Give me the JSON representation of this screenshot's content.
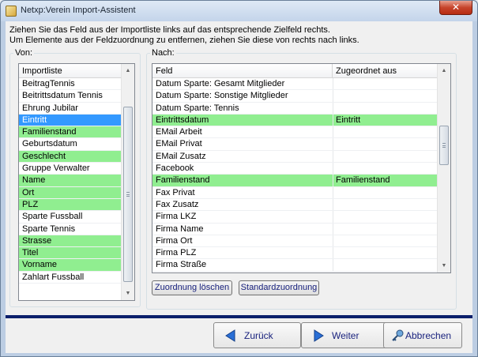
{
  "window": {
    "title": "Netxp:Verein Import-Assistent",
    "close_symbol": "✕"
  },
  "instructions": {
    "line1": "Ziehen Sie das Feld aus der Importliste links auf das entsprechende Zielfeld rechts.",
    "line2": "Um Elemente aus der Feldzuordnung zu entfernen, ziehen Sie diese von rechts nach links."
  },
  "from_group": {
    "label": "Von:",
    "header": "Importliste",
    "items": [
      {
        "label": "BeitragTennis",
        "state": ""
      },
      {
        "label": "Beitrittsdatum Tennis",
        "state": ""
      },
      {
        "label": "Ehrung Jubilar",
        "state": ""
      },
      {
        "label": "Eintritt",
        "state": "selected"
      },
      {
        "label": "Familienstand",
        "state": "green"
      },
      {
        "label": "Geburtsdatum",
        "state": ""
      },
      {
        "label": "Geschlecht",
        "state": "green"
      },
      {
        "label": "Gruppe Verwalter",
        "state": ""
      },
      {
        "label": "Name",
        "state": "green"
      },
      {
        "label": "Ort",
        "state": "green"
      },
      {
        "label": "PLZ",
        "state": "green"
      },
      {
        "label": "Sparte Fussball",
        "state": ""
      },
      {
        "label": "Sparte Tennis",
        "state": ""
      },
      {
        "label": "Strasse",
        "state": "green"
      },
      {
        "label": "Titel",
        "state": "green"
      },
      {
        "label": "Vorname",
        "state": "green"
      },
      {
        "label": "Zahlart Fussball",
        "state": ""
      }
    ]
  },
  "to_group": {
    "label": "Nach:",
    "col_field": "Feld",
    "col_assigned": "Zugeordnet aus",
    "rows": [
      {
        "field": "Datum Sparte: Gesamt Mitglieder",
        "assigned": "",
        "green": false
      },
      {
        "field": "Datum Sparte: Sonstige Mitglieder",
        "assigned": "",
        "green": false
      },
      {
        "field": "Datum Sparte: Tennis",
        "assigned": "",
        "green": false
      },
      {
        "field": "Eintrittsdatum",
        "assigned": "Eintritt",
        "green": true
      },
      {
        "field": "EMail Arbeit",
        "assigned": "",
        "green": false
      },
      {
        "field": "EMail Privat",
        "assigned": "",
        "green": false
      },
      {
        "field": "EMail Zusatz",
        "assigned": "",
        "green": false
      },
      {
        "field": "Facebook",
        "assigned": "",
        "green": false
      },
      {
        "field": "Familienstand",
        "assigned": "Familienstand",
        "green": true
      },
      {
        "field": "Fax Privat",
        "assigned": "",
        "green": false
      },
      {
        "field": "Fax Zusatz",
        "assigned": "",
        "green": false
      },
      {
        "field": "Firma LKZ",
        "assigned": "",
        "green": false
      },
      {
        "field": "Firma Name",
        "assigned": "",
        "green": false
      },
      {
        "field": "Firma Ort",
        "assigned": "",
        "green": false
      },
      {
        "field": "Firma PLZ",
        "assigned": "",
        "green": false
      },
      {
        "field": "Firma Straße",
        "assigned": "",
        "green": false
      }
    ],
    "clear_button": "Zuordnung löschen",
    "default_button": "Standardzuordnung"
  },
  "footer": {
    "back": "Zurück",
    "next": "Weiter",
    "cancel": "Abbrechen"
  },
  "colors": {
    "mapped_row": "#90ee90",
    "selected_row": "#3399ff",
    "footer_band": "#0b1f6b",
    "button_text": "#1a237e"
  },
  "icons": {
    "back": "arrow-left-icon",
    "next": "arrow-right-icon",
    "cancel": "key-icon"
  }
}
